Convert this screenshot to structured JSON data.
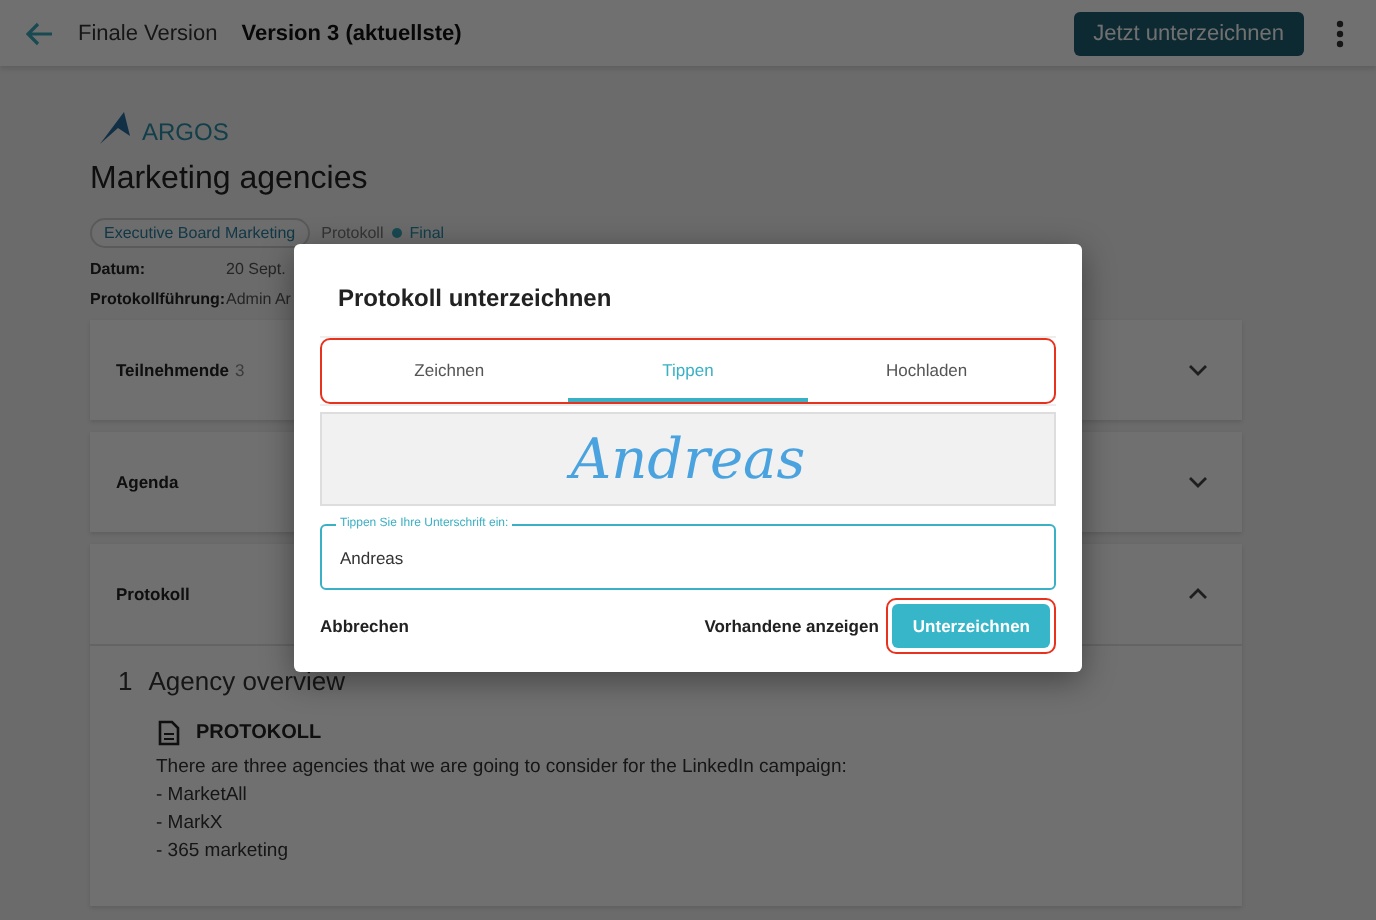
{
  "header": {
    "breadcrumb": "Finale Version",
    "version": "Version 3 (aktuellste)",
    "sign_button": "Jetzt unterzeichnen"
  },
  "document": {
    "logo_text": "ARGOS",
    "title": "Marketing agencies",
    "team_tag": "Executive Board Marketing",
    "type": "Protokoll",
    "status": "Final",
    "fields": [
      {
        "label": "Datum:",
        "value": "20 Sept."
      },
      {
        "label": "Protokollführung:",
        "value": "Admin Ar"
      }
    ],
    "sections": [
      {
        "title": "Teilnehmende",
        "count": "3",
        "expanded": false
      },
      {
        "title": "Agenda",
        "expanded": false
      },
      {
        "title": "Protokoll",
        "expanded": true
      }
    ],
    "protocol": {
      "number": "1",
      "heading": "Agency overview",
      "block_title": "PROTOKOLL",
      "lines": [
        "There are three agencies that we are going to consider for the LinkedIn campaign:",
        "- MarketAll",
        "- MarkX",
        "- 365 marketing"
      ]
    }
  },
  "dialog": {
    "title": "Protokoll unterzeichnen",
    "tabs_highlighted": true,
    "tabs": [
      {
        "label": "Zeichnen",
        "selected": false
      },
      {
        "label": "Tippen",
        "selected": true
      },
      {
        "label": "Hochladen",
        "selected": false
      }
    ],
    "preview": "Andreas",
    "field": {
      "label": "Tippen Sie Ihre Unterschrift ein:",
      "value": "Andreas"
    },
    "cancel": "Abbrechen",
    "show_existing": "Vorhandene anzeigen",
    "sign": {
      "label": "Unterzeichnen",
      "highlighted": true
    }
  }
}
